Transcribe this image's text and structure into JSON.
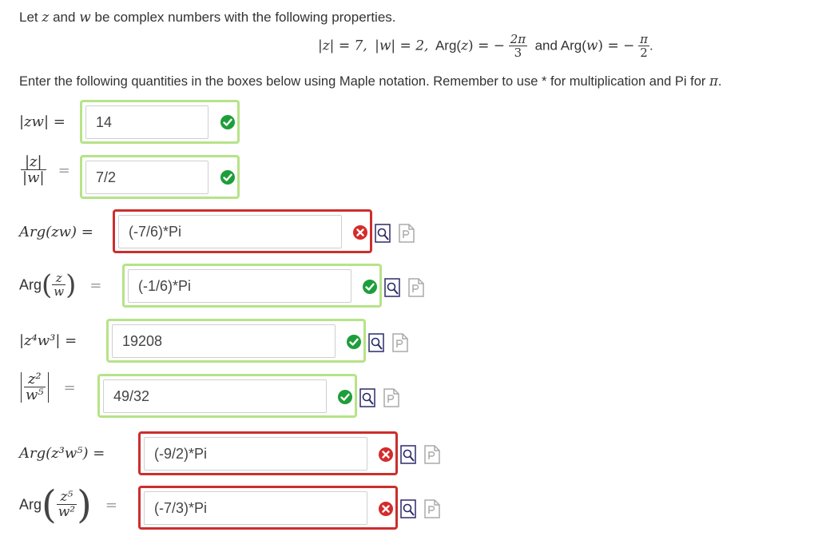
{
  "intro": {
    "prefix": "Let",
    "z": "z",
    "and": "and",
    "w": "w",
    "suffix": "be complex numbers with the following properties."
  },
  "properties": {
    "absz": "|z| = 7,",
    "absw": "|w| = 2,",
    "argz_label": "Arg(",
    "argz_var": "z",
    "argz_eq": ") = −",
    "argz_num": "2π",
    "argz_den": "3",
    "and_text": "and",
    "argw_label": "Arg(",
    "argw_var": "w",
    "argw_eq": ") = −",
    "argw_num": "π",
    "argw_den": "2",
    "period": "."
  },
  "instructions": {
    "text": "Enter the following quantities in the boxes below using Maple notation.  Remember to use * for multiplication and Pi for",
    "pi": "π",
    "end": "."
  },
  "colors": {
    "correct_border": "#b6e388",
    "wrong_border": "#cc2e2e",
    "correct_icon": "#1e9e3a",
    "wrong_icon": "#d52b2b"
  },
  "rows": [
    {
      "label": "|zw| =",
      "value": "14",
      "status": "correct"
    },
    {
      "label_num": "|z|",
      "label_den": "|w|",
      "eq": "=",
      "value": "7/2",
      "status": "correct"
    },
    {
      "label": "Arg(zw) =",
      "value": "(-7/6)*Pi",
      "status": "wrong"
    },
    {
      "label_prefix": "Arg",
      "label_num": "z",
      "label_den": "w",
      "eq": "=",
      "value": "(-1/6)*Pi",
      "status": "correct"
    },
    {
      "label": "|z⁴w³| =",
      "value": "19208",
      "status": "correct"
    },
    {
      "label_num": "z²",
      "label_den": "w⁵",
      "eq": "=",
      "value": "49/32",
      "status": "correct"
    },
    {
      "label": "Arg(z³w⁵) =",
      "value": "(-9/2)*Pi",
      "status": "wrong"
    },
    {
      "label_prefix": "Arg",
      "label_num": "z⁵",
      "label_den": "w²",
      "eq": "=",
      "value": "(-7/3)*Pi",
      "status": "wrong"
    }
  ]
}
